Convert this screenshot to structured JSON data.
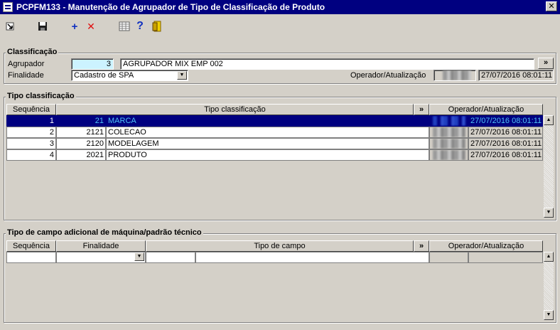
{
  "window": {
    "title": "PCPFM133 - Manutenção de Agrupador de Tipo de Classificação de Produto",
    "close": "✕"
  },
  "toolbar": {
    "add": "+",
    "delete": "✕",
    "help": "?"
  },
  "classificacao": {
    "title": "Classificação",
    "agrupador_label": "Agrupador",
    "agrupador_code": "3",
    "agrupador_desc": "AGRUPADOR MIX EMP 002",
    "more": "»",
    "finalidade_label": "Finalidade",
    "finalidade_value": "Cadastro de SPA",
    "operador_label": "Operador/Atualização",
    "timestamp": "27/07/2016 08:01:11"
  },
  "tipo": {
    "title": "Tipo classificação",
    "headers": {
      "seq": "Sequência",
      "tipo": "Tipo classificação",
      "more": "»",
      "op": "Operador/Atualização"
    },
    "rows": [
      {
        "seq": "1",
        "code": "21",
        "name": "MARCA",
        "ts": "27/07/2016 08:01:11"
      },
      {
        "seq": "2",
        "code": "2121",
        "name": "COLECAO",
        "ts": "27/07/2016 08:01:11"
      },
      {
        "seq": "3",
        "code": "2120",
        "name": "MODELAGEM",
        "ts": "27/07/2016 08:01:11"
      },
      {
        "seq": "4",
        "code": "2021",
        "name": "PRODUTO",
        "ts": "27/07/2016 08:01:11"
      }
    ]
  },
  "campo": {
    "title": "Tipo de campo adicional de máquina/padrão técnico",
    "headers": {
      "seq": "Sequência",
      "fin": "Finalidade",
      "tipo": "Tipo de campo",
      "more": "»",
      "op": "Operador/Atualização"
    }
  },
  "colors": {
    "titlebar": "#000080",
    "face": "#d4d0c8",
    "selection": "#000080",
    "cyan": "#ccf3ff"
  }
}
